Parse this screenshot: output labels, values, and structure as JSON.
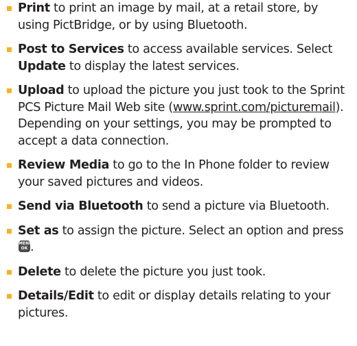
{
  "items": [
    {
      "term": "Print",
      "text": " to print an image by mail, at a retail store, by using PictBridge, or by using Bluetooth."
    },
    {
      "term": "Post to Services",
      "text": " to access available services. Select ",
      "term2": "Update",
      "text2": " to display the latest services."
    },
    {
      "term": "Upload",
      "text": " to upload the picture you just took to the Sprint PCS Picture Mail Web site (",
      "link": "www.sprint.com/picturemail",
      "text2": "). Depending on your settings, you may be prompted to accept a data connection."
    },
    {
      "term": "Review Media",
      "text": " to go to the In Phone folder to review your saved pictures and videos."
    },
    {
      "term": "Send via Bluetooth",
      "text": " to send a picture via Bluetooth."
    },
    {
      "term": "Set as",
      "text": " to assign the picture. Select an option and press ",
      "text2": "."
    },
    {
      "term": "Delete",
      "text": " to delete the picture you just took."
    },
    {
      "term": "Details/Edit",
      "text": " to edit or display details relating to your pictures."
    }
  ],
  "menu_ok_icon": {
    "top": "MENU",
    "bottom": "OK"
  },
  "colors": {
    "bullet": "#f5b324",
    "text": "#231f20",
    "key_bg": "#4a4a4a"
  }
}
